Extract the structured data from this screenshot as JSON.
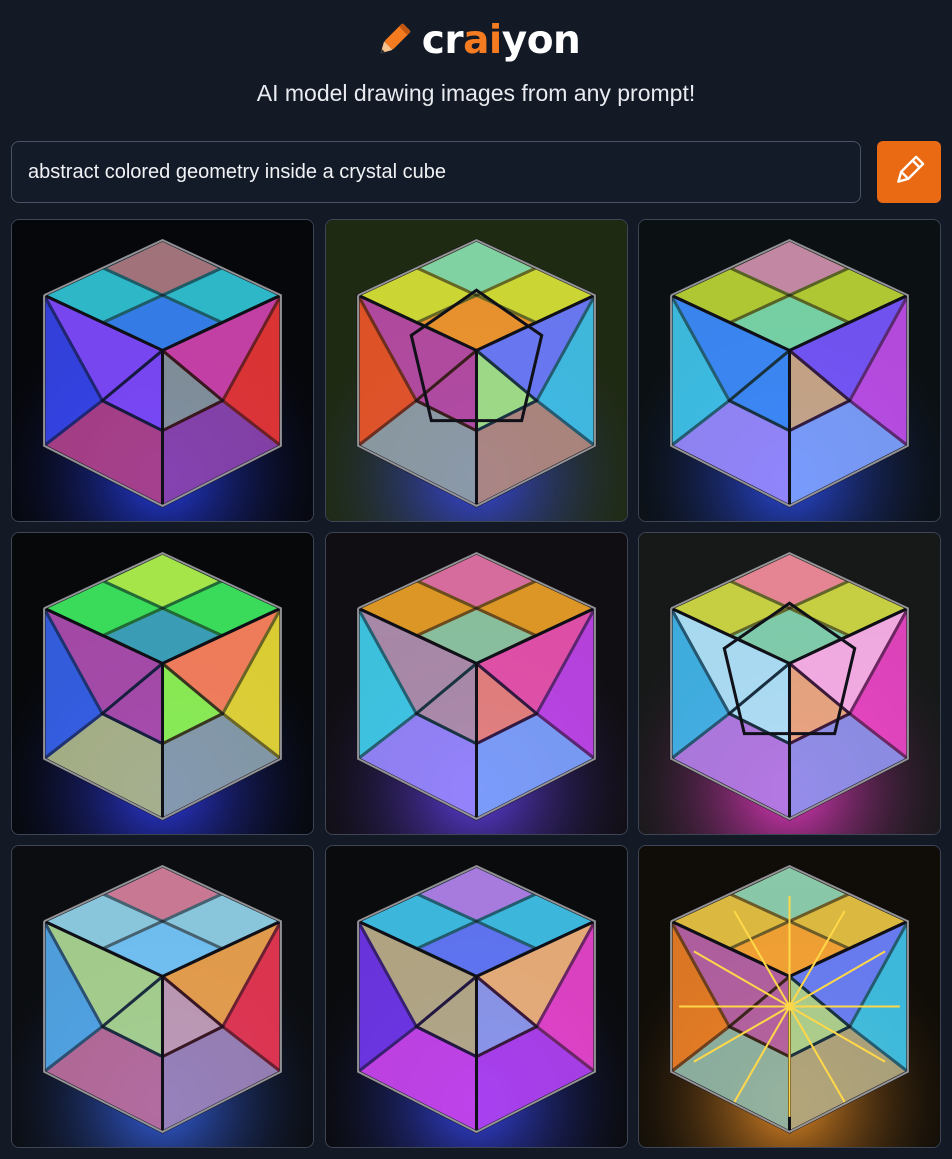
{
  "brand": {
    "name_parts": [
      "cr",
      "ai",
      "yon"
    ],
    "accent_color": "#f47b20",
    "icon": "pencil-icon"
  },
  "tagline": "AI model drawing images from any prompt!",
  "search": {
    "value": "abstract colored geometry inside a crystal cube",
    "button_icon": "pencil-icon",
    "button_color": "#ea6a13"
  },
  "results": [
    {
      "shape": "cube",
      "bg": "#06070b",
      "colors": [
        "#35d6e8",
        "#3b4bff",
        "#ff3b3b",
        "#b04bff"
      ],
      "glow": "#2a44ff"
    },
    {
      "shape": "icosahedron",
      "bg": "#1f2a12",
      "colors": [
        "#e9f33b",
        "#ff5a2a",
        "#45d0ff",
        "#8a43ff"
      ],
      "glow": "#3a49ff"
    },
    {
      "shape": "cube",
      "bg": "#0b1012",
      "colors": [
        "#cde83a",
        "#45d6ff",
        "#d255ff",
        "#3a5bff"
      ],
      "glow": "#2f52ff"
    },
    {
      "shape": "cube",
      "bg": "#06080a",
      "colors": [
        "#45ff6a",
        "#3b6bff",
        "#ffef3b",
        "#ff3b7b"
      ],
      "glow": "#3340ff"
    },
    {
      "shape": "cube",
      "bg": "#100e12",
      "colors": [
        "#ffae2a",
        "#45e0ff",
        "#d24bff",
        "#ff5a7a"
      ],
      "glow": "#6a44ff"
    },
    {
      "shape": "dodecahedron",
      "bg": "#171919",
      "colors": [
        "#e6ef4a",
        "#45c6ff",
        "#ff4bd6",
        "#ffffff"
      ],
      "glow": "#ff3bd6"
    },
    {
      "shape": "cube",
      "bg": "#0b0d10",
      "colors": [
        "#9fe6ff",
        "#5bb8ff",
        "#ff3b5a",
        "#e6ef4a"
      ],
      "glow": "#3a6bff"
    },
    {
      "shape": "cube",
      "bg": "#0a0b0d",
      "colors": [
        "#45d6ff",
        "#7a3bff",
        "#ff4be0",
        "#e9ff3b"
      ],
      "glow": "#3b4bff"
    },
    {
      "shape": "star",
      "bg": "#100d08",
      "colors": [
        "#ffd84a",
        "#ff8a2a",
        "#45d6ff",
        "#8a4bff"
      ],
      "glow": "#ff9a2a"
    }
  ]
}
